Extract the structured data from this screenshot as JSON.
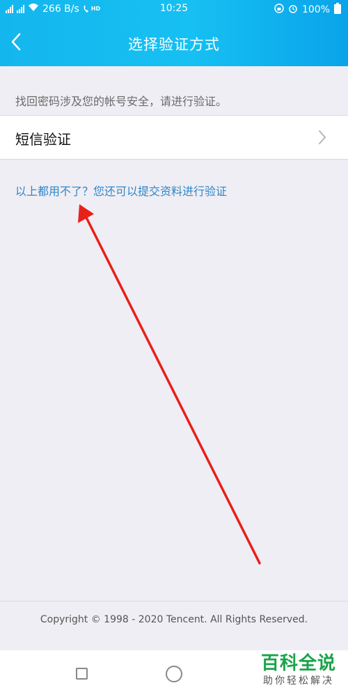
{
  "status_bar": {
    "net_speed": "266 B/s",
    "hd_label": "HD",
    "time": "10:25",
    "battery": "100%",
    "icons": [
      "signal-icon",
      "wifi-icon",
      "volte-icon",
      "lock-rotation-icon",
      "alarm-icon",
      "battery-icon"
    ]
  },
  "header": {
    "title": "选择验证方式",
    "back_icon": "chevron-left-icon"
  },
  "main": {
    "hint": "找回密码涉及您的帐号安全，请进行验证。",
    "options": [
      {
        "label": "短信验证",
        "icon": "chevron-right-icon"
      }
    ],
    "alt_link": "以上都用不了？您还可以提交资料进行验证"
  },
  "annotation": {
    "arrow_color": "#e8201a",
    "icon": "red-arrow-annotation"
  },
  "footer": {
    "copyright": "Copyright © 1998 - 2020 Tencent. All Rights Reserved."
  },
  "nav": {
    "icons": [
      "recent-apps-icon",
      "home-icon"
    ]
  },
  "watermark": {
    "title": "百科全说",
    "subtitle": "助你轻松解决"
  },
  "colors": {
    "header_gradient_start": "#14b6ee",
    "header_gradient_end": "#0aa3ea",
    "link": "#2f86c9",
    "background": "#efeef4",
    "watermark_green": "#1aa34a"
  }
}
